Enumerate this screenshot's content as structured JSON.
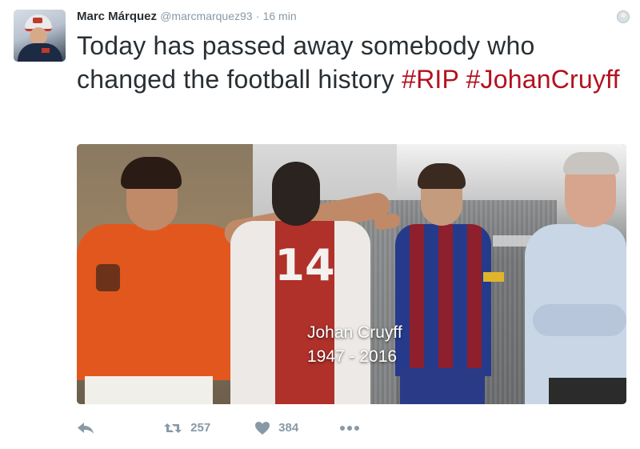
{
  "tweet": {
    "author_name": "Marc Márquez",
    "handle": "@marcmarquez93",
    "separator": "·",
    "time": "16 min",
    "text_plain": "Today has passed away somebody who changed the football history",
    "hashtag_1": "#RIP",
    "hashtag_2": "#JohanCruyff"
  },
  "media": {
    "overlay_name": "Johan Cruyff",
    "overlay_years": "1947 - 2016",
    "jersey_number": "14"
  },
  "actions": {
    "reply_icon": "reply-icon",
    "retweet_icon": "retweet-icon",
    "retweet_count": "257",
    "like_icon": "heart-icon",
    "like_count": "384",
    "more_icon": "more-icon"
  },
  "colors": {
    "hashtag": "#b3121f",
    "muted": "#8899a6",
    "text": "#292f33"
  }
}
